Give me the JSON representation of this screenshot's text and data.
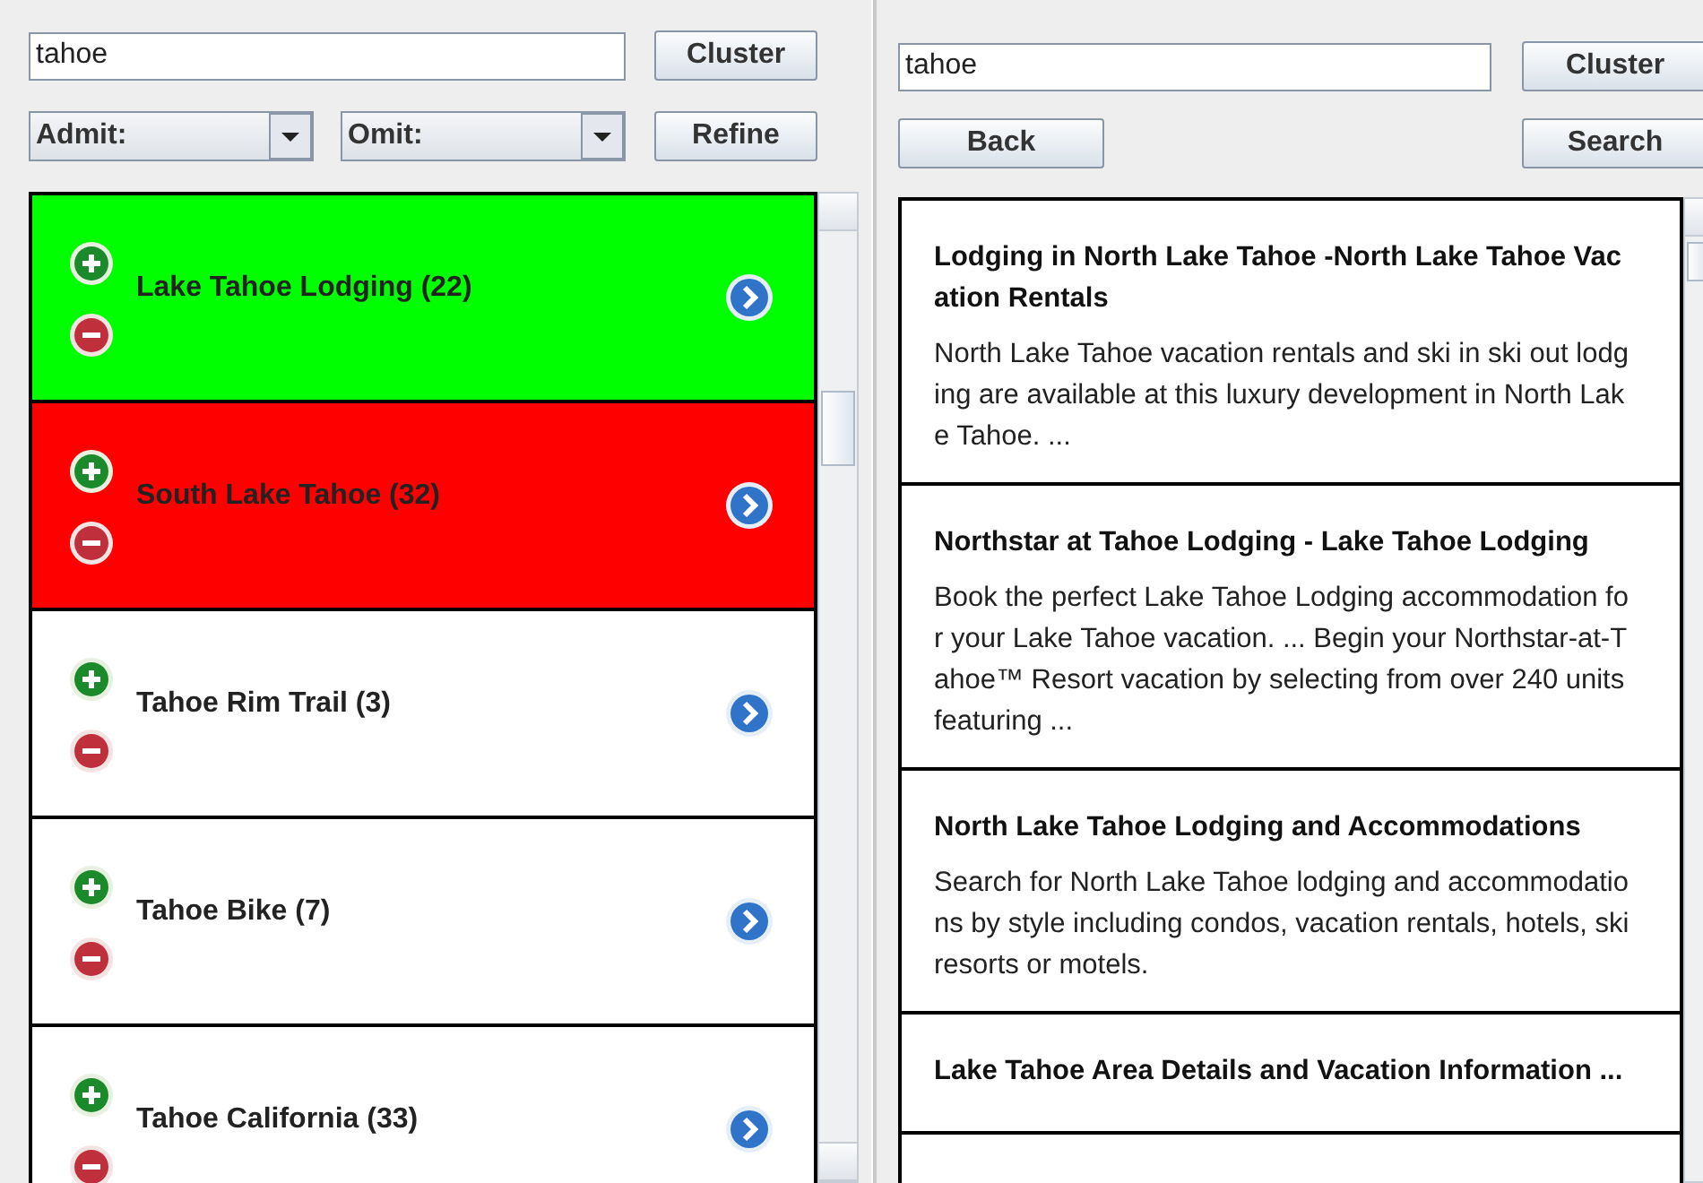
{
  "left_panel": {
    "query": "tahoe",
    "cluster_button": "Cluster",
    "admit": {
      "label": "Admit:"
    },
    "omit": {
      "label": "Omit:"
    },
    "refine_button": "Refine",
    "clusters": [
      {
        "label": "Lake Tahoe Lodging (22)",
        "color": "#00ff00"
      },
      {
        "label": "South Lake Tahoe (32)",
        "color": "#ff0000"
      },
      {
        "label": "Tahoe Rim Trail (3)",
        "color": "#ffffff"
      },
      {
        "label": "Tahoe Bike (7)",
        "color": "#ffffff"
      },
      {
        "label": "Tahoe California (33)",
        "color": "#ffffff"
      }
    ]
  },
  "right_panel": {
    "query": "tahoe",
    "cluster_button": "Cluster",
    "back_button": "Back",
    "search_button": "Search",
    "results": [
      {
        "title": "Lodging in North Lake Tahoe -North Lake Tahoe Vacation Rentals",
        "snippet": "North Lake Tahoe vacation rentals and ski in ski out lodging are available at this luxury development in North Lake Tahoe. ..."
      },
      {
        "title": "Northstar at Tahoe Lodging - Lake Tahoe Lodging",
        "snippet": "Book the perfect Lake Tahoe Lodging accommodation for your Lake Tahoe vacation. ... Begin your Northstar-at-Tahoe™ Resort vacation by selecting from over 240 units featuring ..."
      },
      {
        "title": "North Lake Tahoe Lodging and Accommodations",
        "snippet": "Search for North Lake Tahoe lodging and accommodations by style including condos, vacation rentals, hotels, ski resorts or motels."
      },
      {
        "title": "Lake Tahoe Area Details and Vacation Information ..."
      }
    ]
  }
}
